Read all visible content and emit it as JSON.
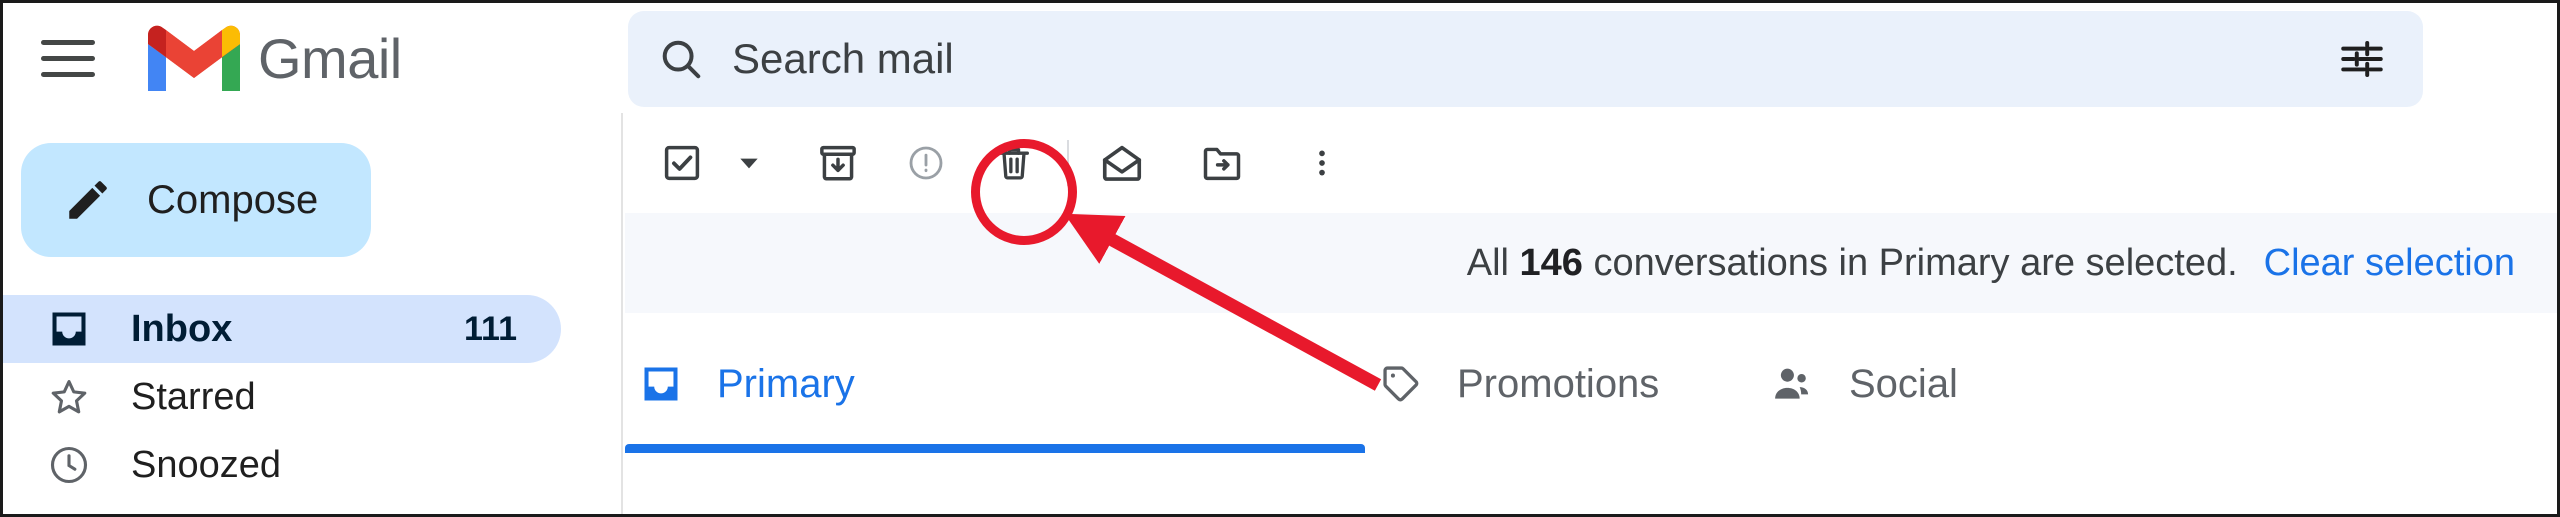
{
  "app": {
    "brand": "Gmail",
    "menu_icon": "hamburger-icon"
  },
  "search": {
    "placeholder": "Search mail",
    "value": "",
    "icon": "search-icon",
    "filter_icon": "filter-options-icon"
  },
  "sidebar": {
    "compose": {
      "label": "Compose",
      "icon": "pencil-icon"
    },
    "items": [
      {
        "label": "Inbox",
        "count": "111",
        "icon": "inbox-icon",
        "active": true
      },
      {
        "label": "Starred",
        "count": "",
        "icon": "star-icon",
        "active": false
      },
      {
        "label": "Snoozed",
        "count": "",
        "icon": "clock-icon",
        "active": false
      }
    ]
  },
  "toolbar": {
    "select_all": {
      "label": "Select",
      "icon": "checkbox-checked-icon"
    },
    "select_caret": {
      "label": "Selection options",
      "icon": "chevron-down-icon"
    },
    "archive": {
      "label": "Archive",
      "icon": "archive-icon"
    },
    "report_spam": {
      "label": "Report spam",
      "icon": "report-spam-icon"
    },
    "delete": {
      "label": "Delete",
      "icon": "trash-icon"
    },
    "mark_unread": {
      "label": "Mark as unread",
      "icon": "envelope-open-icon"
    },
    "move_to": {
      "label": "Move to",
      "icon": "move-to-folder-icon"
    },
    "more": {
      "label": "More",
      "icon": "more-vertical-icon"
    }
  },
  "selection_banner": {
    "prefix": "All",
    "count": "146",
    "suffix": "conversations in Primary are selected.",
    "clear_label": "Clear selection"
  },
  "tabs": [
    {
      "label": "Primary",
      "icon": "inbox-icon",
      "active": true
    },
    {
      "label": "Promotions",
      "icon": "tag-icon",
      "active": false
    },
    {
      "label": "Social",
      "icon": "people-icon",
      "active": false
    }
  ],
  "annotations": {
    "highlight_color": "#e8192c",
    "highlight_target": "delete"
  },
  "colors": {
    "accent_blue": "#1a73e8",
    "search_bg": "#eaf1fb",
    "compose_bg": "#c2e7ff",
    "active_nav_bg": "#d3e3fd",
    "banner_bg": "#f6f8fc",
    "annotation_red": "#e8192c"
  }
}
